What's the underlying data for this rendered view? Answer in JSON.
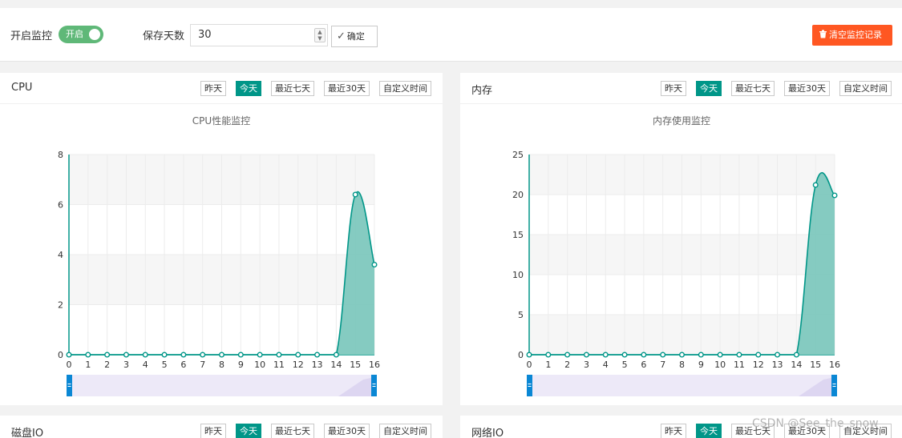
{
  "toolbar": {
    "monitor_label": "开启监控",
    "toggle_label": "开启",
    "keep_days_label": "保存天数",
    "keep_days_value": "30",
    "confirm_label": "确定",
    "clear_label": "清空监控记录"
  },
  "tabs": [
    "昨天",
    "今天",
    "最近七天",
    "最近30天",
    "自定义时间"
  ],
  "active_tab": 1,
  "panels": [
    {
      "title": "CPU",
      "chart_title": "CPU性能监控"
    },
    {
      "title": "内存",
      "chart_title": "内存使用监控"
    },
    {
      "title": "磁盘IO"
    },
    {
      "title": "网络IO"
    }
  ],
  "watermark": "CSDN @See_the_snow",
  "colors": {
    "accent": "#009688",
    "area": "#7ec8be",
    "clear": "#ff5722",
    "toggle": "#5fb878",
    "zoom": "#ede9f8",
    "handle": "#0a87d4"
  },
  "chart_data": [
    {
      "type": "area",
      "title": "CPU性能监控",
      "x": [
        0,
        1,
        2,
        3,
        4,
        5,
        6,
        7,
        8,
        9,
        10,
        11,
        12,
        13,
        14,
        15,
        16
      ],
      "ylim": [
        0,
        8
      ],
      "yticks": [
        0,
        2,
        4,
        6,
        8
      ],
      "series": [
        {
          "values": [
            0,
            0,
            0,
            0,
            0,
            0,
            0,
            0,
            0,
            0,
            0,
            0,
            0,
            0,
            0,
            6.4,
            3.6
          ]
        }
      ],
      "grid": true
    },
    {
      "type": "area",
      "title": "内存使用监控",
      "x": [
        0,
        1,
        2,
        3,
        4,
        5,
        6,
        7,
        8,
        9,
        10,
        11,
        12,
        13,
        14,
        15,
        16
      ],
      "ylim": [
        0,
        25
      ],
      "yticks": [
        0,
        5,
        10,
        15,
        20,
        25
      ],
      "series": [
        {
          "values": [
            0,
            0,
            0,
            0,
            0,
            0,
            0,
            0,
            0,
            0,
            0,
            0,
            0,
            0,
            0,
            21.2,
            19.9
          ]
        }
      ],
      "grid": true
    }
  ]
}
